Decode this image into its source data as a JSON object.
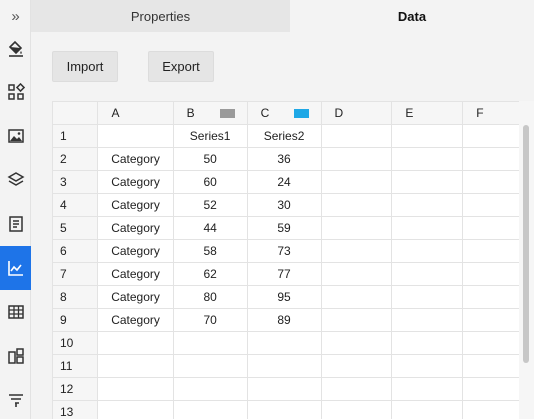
{
  "tabs": {
    "properties": "Properties",
    "data": "Data"
  },
  "rail": {
    "expand_glyph": "»"
  },
  "toolbar": {
    "import_label": "Import",
    "export_label": "Export"
  },
  "colors": {
    "accent": "#1e74e8",
    "series1": "#9a9a9a",
    "series2": "#1ea8e6"
  },
  "grid": {
    "columns": [
      "A",
      "B",
      "C",
      "D",
      "E",
      "F"
    ],
    "rows": [
      {
        "n": "1",
        "a": "",
        "b": "Series1",
        "c": "Series2"
      },
      {
        "n": "2",
        "a": "Category",
        "b": "50",
        "c": "36"
      },
      {
        "n": "3",
        "a": "Category",
        "b": "60",
        "c": "24"
      },
      {
        "n": "4",
        "a": "Category",
        "b": "52",
        "c": "30"
      },
      {
        "n": "5",
        "a": "Category",
        "b": "44",
        "c": "59"
      },
      {
        "n": "6",
        "a": "Category",
        "b": "58",
        "c": "73"
      },
      {
        "n": "7",
        "a": "Category",
        "b": "62",
        "c": "77"
      },
      {
        "n": "8",
        "a": "Category",
        "b": "80",
        "c": "95"
      },
      {
        "n": "9",
        "a": "Category",
        "b": "70",
        "c": "89"
      },
      {
        "n": "10",
        "a": "",
        "b": "",
        "c": ""
      },
      {
        "n": "11",
        "a": "",
        "b": "",
        "c": ""
      },
      {
        "n": "12",
        "a": "",
        "b": "",
        "c": ""
      },
      {
        "n": "13",
        "a": "",
        "b": "",
        "c": ""
      }
    ]
  }
}
